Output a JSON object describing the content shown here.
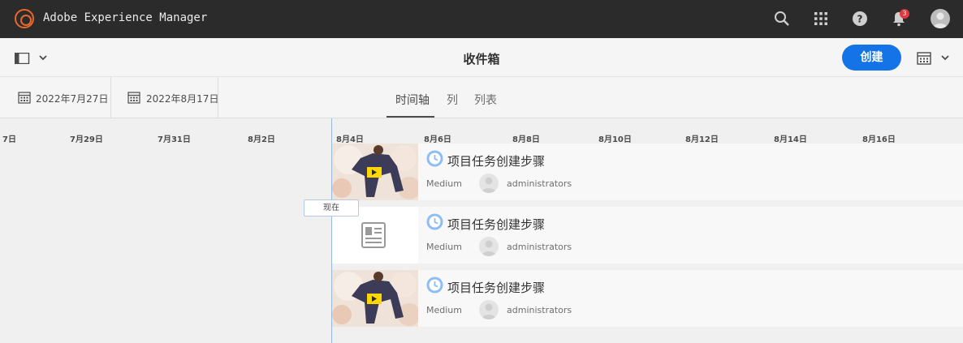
{
  "app": {
    "title": "Adobe Experience Manager",
    "notification_count": "3"
  },
  "actionbar": {
    "title": "收件箱",
    "create_label": "创建"
  },
  "filters": {
    "start_date": "2022年7月27日",
    "end_date": "2022年8月17日"
  },
  "tabs": [
    {
      "label": "时间轴",
      "active": true
    },
    {
      "label": "列",
      "active": false
    },
    {
      "label": "列表",
      "active": false
    }
  ],
  "timeline": {
    "ticks": [
      "7日",
      "7月29日",
      "7月31日",
      "8月2日",
      "8月4日",
      "8月6日",
      "8月8日",
      "8月10日",
      "8月12日",
      "8月14日",
      "8月16日"
    ],
    "now_label": "现在"
  },
  "items": [
    {
      "title": "项目任务创建步骤",
      "priority": "Medium",
      "assignee": "administrators",
      "thumbnail": "video"
    },
    {
      "title": "项目任务创建步骤",
      "priority": "Medium",
      "assignee": "administrators",
      "thumbnail": "document-icon"
    },
    {
      "title": "项目任务创建步骤",
      "priority": "Medium",
      "assignee": "administrators",
      "thumbnail": "video"
    }
  ],
  "colors": {
    "accent": "#1473e6",
    "shell": "#2b2b2b",
    "logo": "#e8682d",
    "badge": "#e0383e"
  }
}
